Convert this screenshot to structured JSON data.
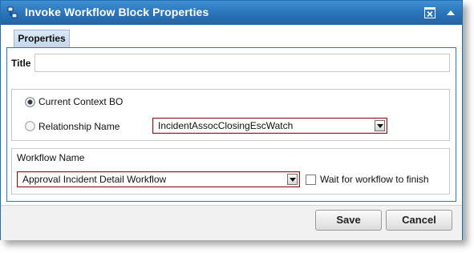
{
  "dialog": {
    "title": "Invoke Workflow Block Properties",
    "accent_color": "#2a73b9",
    "icons": {
      "title": "workflow-icon",
      "close": "close-window-icon",
      "collapse": "collapse-arrow-icon"
    }
  },
  "tabs": [
    {
      "label": "Properties",
      "active": true
    }
  ],
  "form": {
    "title_label": "Title",
    "title_value": "",
    "context": {
      "options": [
        {
          "label": "Current Context BO",
          "selected": true
        },
        {
          "label": "Relationship Name",
          "selected": false
        }
      ],
      "relationship_select_value": "IncidentAssocClosingEscWatch"
    },
    "workflow": {
      "label": "Workflow Name",
      "select_value": "Approval Incident Detail Workflow",
      "wait_label": "Wait for workflow to finish",
      "wait_checked": false
    }
  },
  "footer": {
    "save_label": "Save",
    "cancel_label": "Cancel"
  }
}
